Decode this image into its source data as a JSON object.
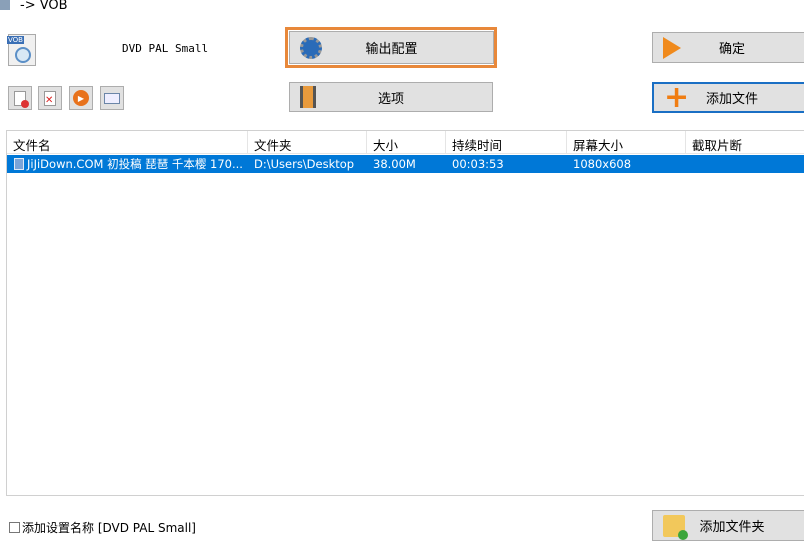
{
  "window": {
    "title": "-> VOB"
  },
  "profile": {
    "name": "DVD PAL Small",
    "format_badge": "VOB"
  },
  "buttons": {
    "output_config": "输出配置",
    "options": "选项",
    "ok": "确定",
    "add_file": "添加文件",
    "add_folder": "添加文件夹"
  },
  "toolbar": [
    {
      "icon": "remove-file-icon"
    },
    {
      "icon": "clear-list-icon"
    },
    {
      "icon": "play-icon"
    },
    {
      "icon": "media-info-icon"
    }
  ],
  "table": {
    "columns": [
      "文件名",
      "文件夹",
      "大小",
      "持续时间",
      "屏幕大小",
      "截取片断"
    ],
    "rows": [
      {
        "name": "JiJiDown.COM 初投稿 琵琶 千本樱 170...",
        "folder": "D:\\Users\\Desktop",
        "size": "38.00M",
        "duration": "00:03:53",
        "resolution": "1080x608",
        "clip": ""
      }
    ]
  },
  "footer": {
    "checkbox_label": "添加设置名称 [DVD PAL Small]",
    "checked": false
  },
  "colors": {
    "accent_orange": "#e8883a",
    "selection": "#0078d7",
    "focus_blue": "#1a6fc4"
  }
}
